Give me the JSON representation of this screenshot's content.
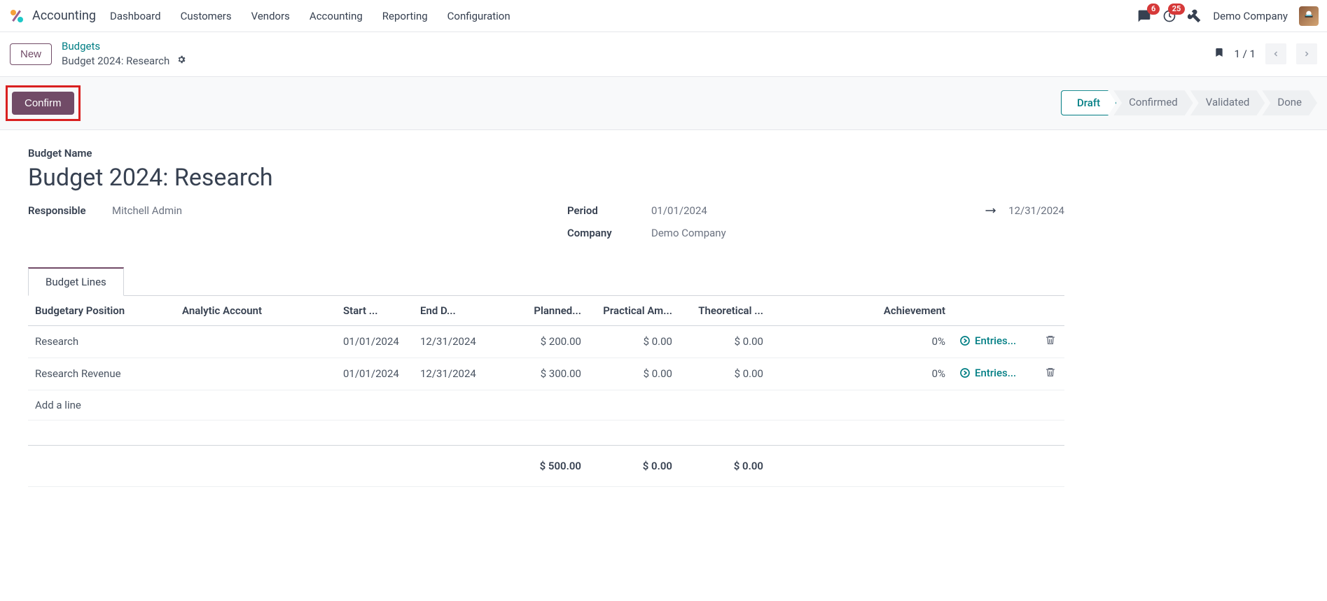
{
  "app": {
    "name": "Accounting"
  },
  "nav": {
    "items": [
      "Dashboard",
      "Customers",
      "Vendors",
      "Accounting",
      "Reporting",
      "Configuration"
    ],
    "messages_badge": "6",
    "activities_badge": "25",
    "company": "Demo Company"
  },
  "breadcrumb": {
    "new_label": "New",
    "parent": "Budgets",
    "current": "Budget 2024: Research"
  },
  "pager": {
    "text": "1 / 1"
  },
  "actions": {
    "confirm": "Confirm"
  },
  "status_steps": [
    "Draft",
    "Confirmed",
    "Validated",
    "Done"
  ],
  "form": {
    "name_label": "Budget Name",
    "name_value": "Budget 2024: Research",
    "responsible_label": "Responsible",
    "responsible_value": "Mitchell Admin",
    "period_label": "Period",
    "period_start": "01/01/2024",
    "period_end": "12/31/2024",
    "company_label": "Company",
    "company_value": "Demo Company"
  },
  "tabs": {
    "budget_lines": "Budget Lines"
  },
  "table": {
    "headers": {
      "budgetary_position": "Budgetary Position",
      "analytic_account": "Analytic Account",
      "start": "Start ...",
      "end": "End D...",
      "planned": "Planned...",
      "practical": "Practical Am...",
      "theoretical": "Theoretical ...",
      "achievement": "Achievement"
    },
    "rows": [
      {
        "position": "Research",
        "analytic": "",
        "start": "01/01/2024",
        "end": "12/31/2024",
        "planned": "$ 200.00",
        "practical": "$ 0.00",
        "theoretical": "$ 0.00",
        "achievement": "0%",
        "entries": "Entries..."
      },
      {
        "position": "Research Revenue",
        "analytic": "",
        "start": "01/01/2024",
        "end": "12/31/2024",
        "planned": "$ 300.00",
        "practical": "$ 0.00",
        "theoretical": "$ 0.00",
        "achievement": "0%",
        "entries": "Entries..."
      }
    ],
    "add_line": "Add a line",
    "totals": {
      "planned": "$ 500.00",
      "practical": "$ 0.00",
      "theoretical": "$ 0.00"
    }
  }
}
